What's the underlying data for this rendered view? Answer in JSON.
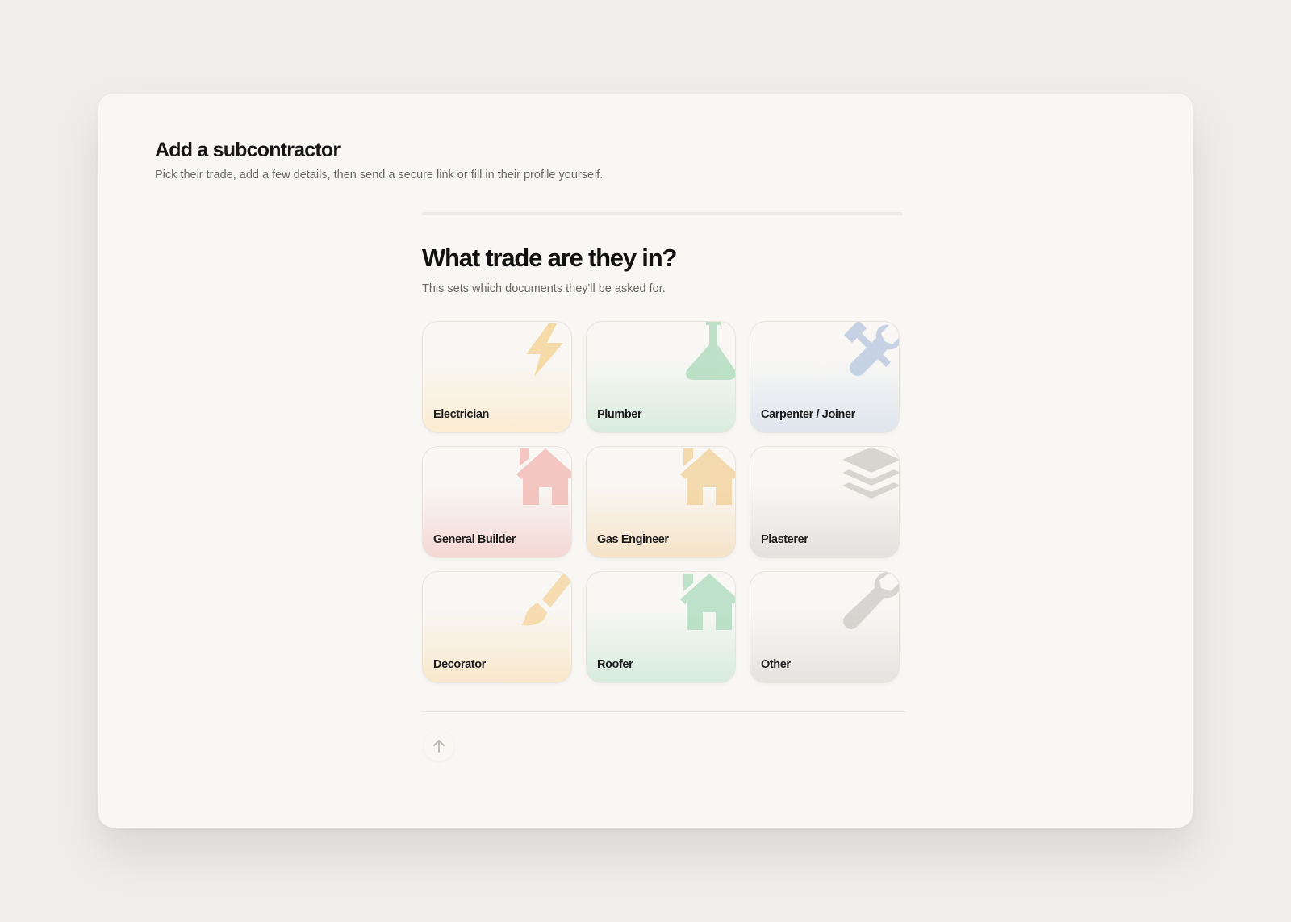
{
  "header": {
    "title": "Add a subcontractor",
    "subtitle": "Pick their trade, add a few details, then send a secure link or fill in their profile yourself."
  },
  "step": {
    "title": "What trade are they in?",
    "subtitle": "This sets which documents they'll be asked for."
  },
  "trades": [
    {
      "label": "Electrician",
      "icon": "lightning-icon",
      "color": "#f5c46a",
      "tint": "#fbecd2"
    },
    {
      "label": "Plumber",
      "icon": "flask-icon",
      "color": "#8fcfa5",
      "tint": "#d9ecdd"
    },
    {
      "label": "Carpenter / Joiner",
      "icon": "tools-icon",
      "color": "#9db4d6",
      "tint": "#dfe5ee"
    },
    {
      "label": "General Builder",
      "icon": "house-icon",
      "color": "#ee9f97",
      "tint": "#f5d8d4"
    },
    {
      "label": "Gas Engineer",
      "icon": "house-icon",
      "color": "#f0c275",
      "tint": "#f6e3c7"
    },
    {
      "label": "Plasterer",
      "icon": "layers-icon",
      "color": "#bdbab4",
      "tint": "#e3e1dd"
    },
    {
      "label": "Decorator",
      "icon": "paintbrush-icon",
      "color": "#f5c77a",
      "tint": "#f8e8cb"
    },
    {
      "label": "Roofer",
      "icon": "house-icon",
      "color": "#8fd0a8",
      "tint": "#d7ecdd"
    },
    {
      "label": "Other",
      "icon": "wrench-icon",
      "color": "#bcbab5",
      "tint": "#e4e3e0"
    }
  ],
  "nav": {
    "back_icon": "arrow-up-icon"
  }
}
